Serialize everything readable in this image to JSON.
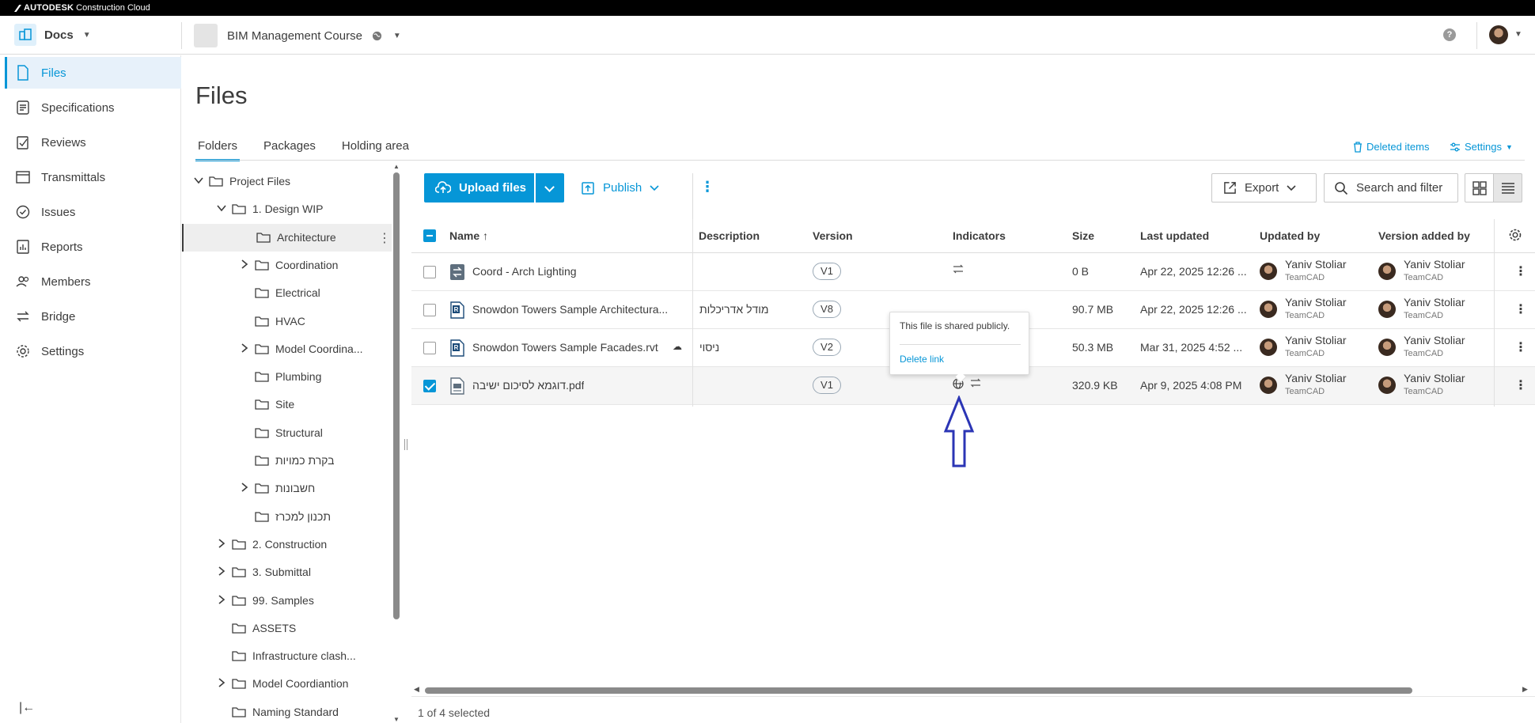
{
  "brand": {
    "bold": "AUTODESK",
    "rest": "Construction Cloud"
  },
  "header": {
    "app_name": "Docs",
    "project_name": "BIM Management Course",
    "help": "?"
  },
  "nav": {
    "items": [
      {
        "label": "Files",
        "icon": "file-icon"
      },
      {
        "label": "Specifications",
        "icon": "specifications-icon"
      },
      {
        "label": "Reviews",
        "icon": "reviews-icon"
      },
      {
        "label": "Transmittals",
        "icon": "transmittals-icon"
      },
      {
        "label": "Issues",
        "icon": "issues-icon"
      },
      {
        "label": "Reports",
        "icon": "reports-icon"
      },
      {
        "label": "Members",
        "icon": "members-icon"
      },
      {
        "label": "Bridge",
        "icon": "bridge-icon"
      },
      {
        "label": "Settings",
        "icon": "settings-icon"
      }
    ],
    "collapse": "|←"
  },
  "page": {
    "title": "Files",
    "tabs": [
      "Folders",
      "Packages",
      "Holding area"
    ],
    "deleted_items": "Deleted items",
    "settings": "Settings"
  },
  "tree": [
    {
      "label": "Project Files",
      "level": 0,
      "expanded": true
    },
    {
      "label": "1. Design WIP",
      "level": 1,
      "expanded": true
    },
    {
      "label": "Architecture",
      "level": 2,
      "selected": true
    },
    {
      "label": "Coordination",
      "level": 2,
      "collapsed": true
    },
    {
      "label": "Electrical",
      "level": 2
    },
    {
      "label": "HVAC",
      "level": 2
    },
    {
      "label": "Model Coordina...",
      "level": 2,
      "collapsed": true
    },
    {
      "label": "Plumbing",
      "level": 2
    },
    {
      "label": "Site",
      "level": 2
    },
    {
      "label": "Structural",
      "level": 2
    },
    {
      "label": "בקרת כמויות",
      "level": 2
    },
    {
      "label": "חשבונות",
      "level": 2,
      "collapsed": true
    },
    {
      "label": "תכנון למכרז",
      "level": 2
    },
    {
      "label": "2. Construction",
      "level": 1,
      "collapsed": true
    },
    {
      "label": "3. Submittal",
      "level": 1,
      "collapsed": true
    },
    {
      "label": "99. Samples",
      "level": 1,
      "collapsed": true
    },
    {
      "label": "ASSETS",
      "level": 1
    },
    {
      "label": "Infrastructure clash...",
      "level": 1
    },
    {
      "label": "Model Coordiantion",
      "level": 1,
      "collapsed": true
    },
    {
      "label": "Naming Standard",
      "level": 1
    }
  ],
  "toolbar": {
    "upload": "Upload files",
    "publish": "Publish",
    "more": "⋮",
    "export": "Export",
    "search": "Search and filter"
  },
  "table": {
    "headers": {
      "name": "Name",
      "description": "Description",
      "version": "Version",
      "indicators": "Indicators",
      "size": "Size",
      "last_updated": "Last updated",
      "updated_by": "Updated by",
      "version_added_by": "Version added by"
    },
    "rows": [
      {
        "name": "Coord - Arch Lighting",
        "description": "",
        "version": "V1",
        "size": "0 B",
        "last_updated": "Apr 22, 2025 12:26 ...",
        "updated_by": "Yaniv Stoliar",
        "updated_by_co": "TeamCAD",
        "added_by": "Yaniv Stoliar",
        "added_by_co": "TeamCAD",
        "selected": false
      },
      {
        "name": "Snowdon Towers Sample Architectura...",
        "description": "מודל אדריכלות",
        "version": "V8",
        "size": "90.7 MB",
        "last_updated": "Apr 22, 2025 12:26 ...",
        "updated_by": "Yaniv Stoliar",
        "updated_by_co": "TeamCAD",
        "added_by": "Yaniv Stoliar",
        "added_by_co": "TeamCAD",
        "selected": false
      },
      {
        "name": "Snowdon Towers Sample Facades.rvt",
        "description": "ניסוי",
        "version": "V2",
        "size": "50.3 MB",
        "last_updated": "Mar 31, 2025 4:52 ...",
        "updated_by": "Yaniv Stoliar",
        "updated_by_co": "TeamCAD",
        "added_by": "Yaniv Stoliar",
        "added_by_co": "TeamCAD",
        "selected": false
      },
      {
        "name": "דוגמא לסיכום ישיבה.pdf",
        "description": "",
        "version": "V1",
        "size": "320.9 KB",
        "last_updated": "Apr 9, 2025 4:08 PM",
        "updated_by": "Yaniv Stoliar",
        "updated_by_co": "TeamCAD",
        "added_by": "Yaniv Stoliar",
        "added_by_co": "TeamCAD",
        "selected": true
      }
    ]
  },
  "popover": {
    "text": "This file is shared publicly.",
    "link": "Delete link"
  },
  "footer": {
    "selected": "1 of 4 selected"
  },
  "colors": {
    "accent": "#0696d7",
    "annotation_arrow": "#2b35b5"
  }
}
